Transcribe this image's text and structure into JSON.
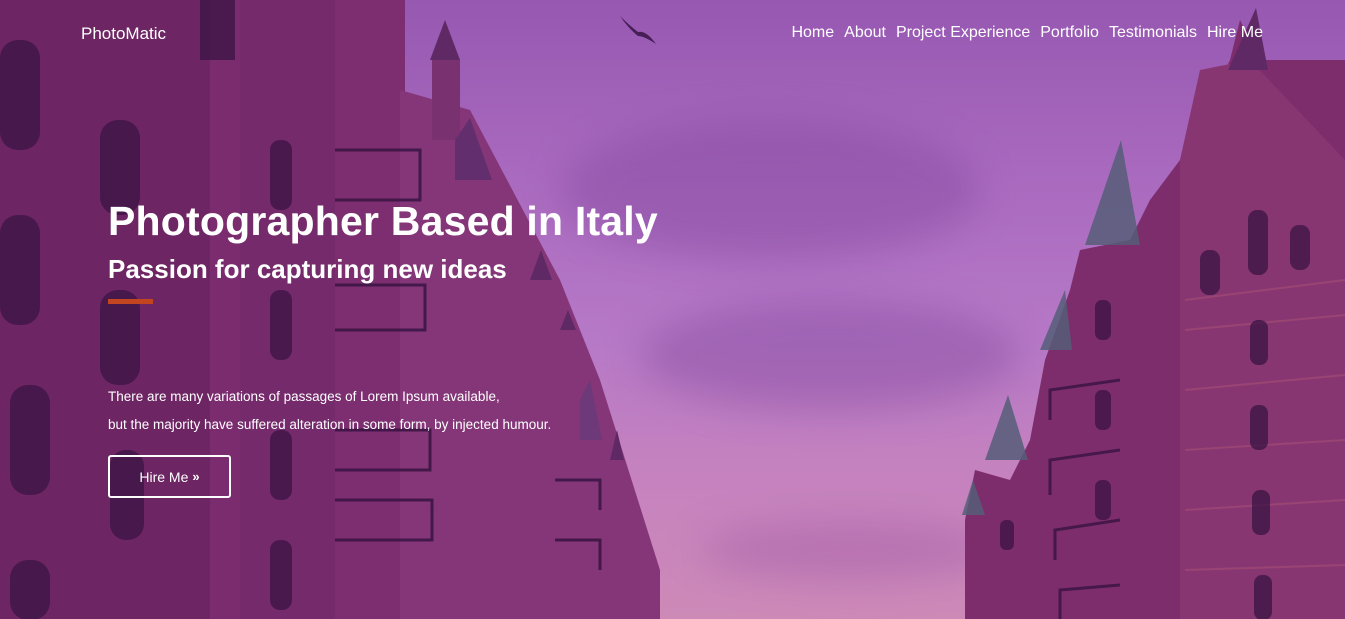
{
  "brand": {
    "name": "PhotoMatic"
  },
  "nav": {
    "items": [
      {
        "label": "Home"
      },
      {
        "label": "About"
      },
      {
        "label": "Project Experience"
      },
      {
        "label": "Portfolio"
      },
      {
        "label": "Testimonials"
      },
      {
        "label": "Hire Me"
      }
    ]
  },
  "hero": {
    "title": "Photographer Based in Italy",
    "subtitle": "Passion for capturing new ideas",
    "description_line1": "There are many variations of passages of Lorem Ipsum available,",
    "description_line2": "but the majority have suffered alteration in some form, by injected humour.",
    "button_label": "Hire Me",
    "button_icon": "double-chevron-right-icon",
    "button_icon_glyph": "»",
    "accent_color": "#c2451f",
    "background_image": "purple-tinted-street-brick-buildings"
  }
}
